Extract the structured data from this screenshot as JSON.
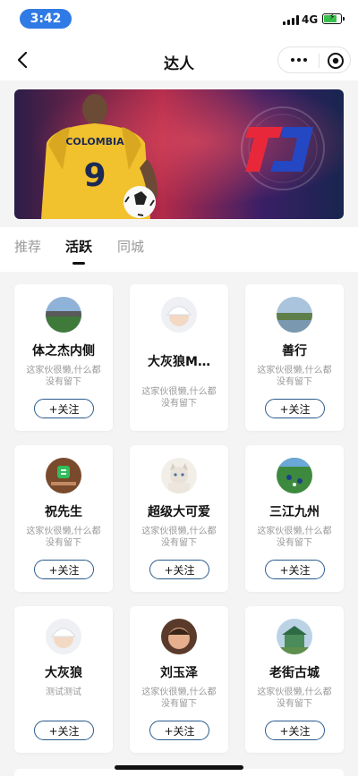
{
  "status_bar": {
    "time": "3:42",
    "network": "4G"
  },
  "nav": {
    "title": "达人"
  },
  "tabs": [
    {
      "label": "推荐"
    },
    {
      "label": "活跃"
    },
    {
      "label": "同城"
    }
  ],
  "cards": [
    {
      "name": "体之杰内侧",
      "desc": "这家伙很懒,什么都没有留下",
      "follow": "+关注",
      "avatar": "stadium"
    },
    {
      "name": "大灰狼M…",
      "desc": "这家伙很懒,什么都没有留下",
      "follow": "+关注",
      "avatar": "baby"
    },
    {
      "name": "善行",
      "desc": "这家伙很懒,什么都没有留下",
      "follow": "+关注",
      "avatar": "landscape"
    },
    {
      "name": "祝先生",
      "desc": "这家伙很懒,什么都没有留下",
      "follow": "+关注",
      "avatar": "app-logo"
    },
    {
      "name": "超级大可爱",
      "desc": "这家伙很懒,什么都没有留下",
      "follow": "+关注",
      "avatar": "kitten"
    },
    {
      "name": "三江九州",
      "desc": "这家伙很懒,什么都没有留下",
      "follow": "+关注",
      "avatar": "soccer-field"
    },
    {
      "name": "大灰狼",
      "desc": "测试测试",
      "follow": "+关注",
      "avatar": "baby"
    },
    {
      "name": "刘玉泽",
      "desc": "这家伙很懒,什么都没有留下",
      "follow": "+关注",
      "avatar": "child"
    },
    {
      "name": "老街古城",
      "desc": "这家伙很懒,什么都没有留下",
      "follow": "+关注",
      "avatar": "pavilion"
    }
  ],
  "colors": {
    "accent_border": "#2a5a8c",
    "time_pill": "#2f7ae5",
    "battery": "#38c14a"
  }
}
